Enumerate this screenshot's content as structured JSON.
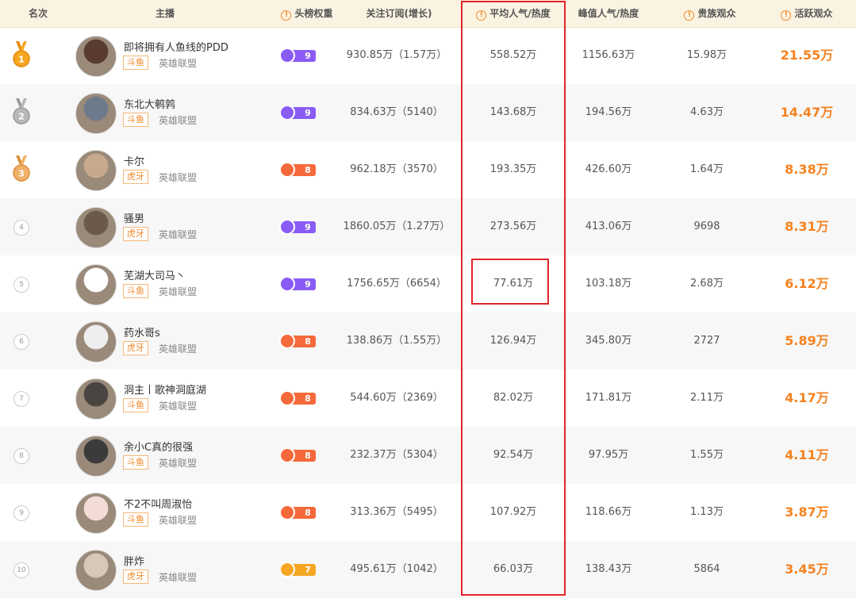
{
  "headers": {
    "rank": "名次",
    "streamer": "主播",
    "weight": "头榜权重",
    "follow": "关注订阅(增长)",
    "avg": "平均人气/热度",
    "peak": "峰值人气/热度",
    "noble": "贵族观众",
    "active": "活跃观众"
  },
  "colors": {
    "purple_badge": "#8a5cf5",
    "orange_badge": "#f5693a",
    "gold_badge": "#f5a623",
    "highlight_red": "#e5232b",
    "active_orange": "#f5821f"
  },
  "rows": [
    {
      "rank": "1",
      "medal": "gold",
      "name": "即将拥有人鱼线的PDD",
      "platform": "斗鱼",
      "game": "英雄联盟",
      "weight": "9",
      "weight_style": "purple",
      "follow": "930.85万（1.57万）",
      "avg": "558.52万",
      "peak": "1156.63万",
      "noble": "15.98万",
      "active": "21.55万"
    },
    {
      "rank": "2",
      "medal": "silver",
      "name": "东北大鹌鹑",
      "platform": "斗鱼",
      "game": "英雄联盟",
      "weight": "9",
      "weight_style": "purple",
      "follow": "834.63万（5140）",
      "avg": "143.68万",
      "peak": "194.56万",
      "noble": "4.63万",
      "active": "14.47万"
    },
    {
      "rank": "3",
      "medal": "bronze",
      "name": "卡尔",
      "platform": "虎牙",
      "game": "英雄联盟",
      "weight": "8",
      "weight_style": "orange",
      "follow": "962.18万（3570）",
      "avg": "193.35万",
      "peak": "426.60万",
      "noble": "1.64万",
      "active": "8.38万"
    },
    {
      "rank": "4",
      "medal": "",
      "name": "骚男",
      "platform": "虎牙",
      "game": "英雄联盟",
      "weight": "9",
      "weight_style": "purple",
      "follow": "1860.05万（1.27万）",
      "avg": "273.56万",
      "peak": "413.06万",
      "noble": "9698",
      "active": "8.31万"
    },
    {
      "rank": "5",
      "medal": "",
      "name": "芜湖大司马丶",
      "platform": "斗鱼",
      "game": "英雄联盟",
      "weight": "9",
      "weight_style": "purple",
      "follow": "1756.65万（6654）",
      "avg": "77.61万",
      "peak": "103.18万",
      "noble": "2.68万",
      "active": "6.12万"
    },
    {
      "rank": "6",
      "medal": "",
      "name": "药水哥s",
      "platform": "虎牙",
      "game": "英雄联盟",
      "weight": "8",
      "weight_style": "orange",
      "follow": "138.86万（1.55万）",
      "avg": "126.94万",
      "peak": "345.80万",
      "noble": "2727",
      "active": "5.89万"
    },
    {
      "rank": "7",
      "medal": "",
      "name": "洞主丨歌神洞庭湖",
      "platform": "斗鱼",
      "game": "英雄联盟",
      "weight": "8",
      "weight_style": "orange",
      "follow": "544.60万（2369）",
      "avg": "82.02万",
      "peak": "171.81万",
      "noble": "2.11万",
      "active": "4.17万"
    },
    {
      "rank": "8",
      "medal": "",
      "name": "余小C真的很强",
      "platform": "斗鱼",
      "game": "英雄联盟",
      "weight": "8",
      "weight_style": "orange",
      "follow": "232.37万（5304）",
      "avg": "92.54万",
      "peak": "97.95万",
      "noble": "1.55万",
      "active": "4.11万"
    },
    {
      "rank": "9",
      "medal": "",
      "name": "不2不叫周淑怡",
      "platform": "斗鱼",
      "game": "英雄联盟",
      "weight": "8",
      "weight_style": "orange",
      "follow": "313.36万（5495）",
      "avg": "107.92万",
      "peak": "118.66万",
      "noble": "1.13万",
      "active": "3.87万"
    },
    {
      "rank": "10",
      "medal": "",
      "name": "胖炸",
      "platform": "虎牙",
      "game": "英雄联盟",
      "weight": "7",
      "weight_style": "gold",
      "follow": "495.61万（1042）",
      "avg": "66.03万",
      "peak": "138.43万",
      "noble": "5864",
      "active": "3.45万"
    }
  ]
}
